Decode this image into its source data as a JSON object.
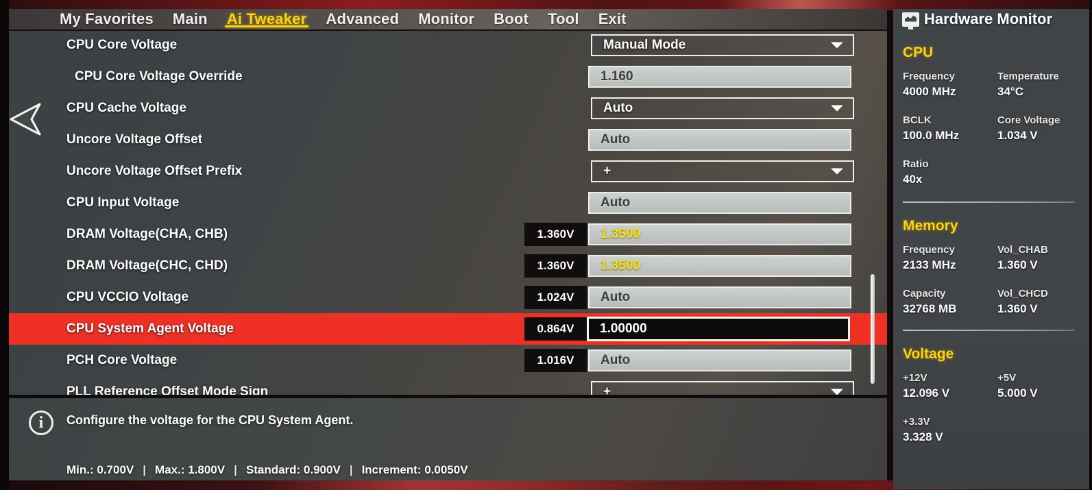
{
  "nav": {
    "items": [
      {
        "label": "My Favorites",
        "active": false
      },
      {
        "label": "Main",
        "active": false
      },
      {
        "label": "Ai Tweaker",
        "active": true
      },
      {
        "label": "Advanced",
        "active": false
      },
      {
        "label": "Monitor",
        "active": false
      },
      {
        "label": "Boot",
        "active": false
      },
      {
        "label": "Tool",
        "active": false
      },
      {
        "label": "Exit",
        "active": false
      }
    ]
  },
  "settings": {
    "rows": [
      {
        "label": "CPU Core Voltage",
        "indent": false,
        "control": "select",
        "value": "Manual Mode",
        "measured": null,
        "highlighted": false,
        "valueStyle": "normal"
      },
      {
        "label": "CPU Core Voltage Override",
        "indent": true,
        "control": "input",
        "value": "1.160",
        "measured": null,
        "highlighted": false,
        "valueStyle": "normal"
      },
      {
        "label": "CPU Cache Voltage",
        "indent": false,
        "control": "select",
        "value": "Auto",
        "measured": null,
        "highlighted": false,
        "valueStyle": "normal"
      },
      {
        "label": "Uncore Voltage Offset",
        "indent": false,
        "control": "input",
        "value": "Auto",
        "measured": null,
        "highlighted": false,
        "valueStyle": "normal"
      },
      {
        "label": "Uncore Voltage Offset Prefix",
        "indent": false,
        "control": "select",
        "value": "+",
        "measured": null,
        "highlighted": false,
        "valueStyle": "normal"
      },
      {
        "label": "CPU Input Voltage",
        "indent": false,
        "control": "input",
        "value": "Auto",
        "measured": null,
        "highlighted": false,
        "valueStyle": "normal"
      },
      {
        "label": "DRAM Voltage(CHA, CHB)",
        "indent": false,
        "control": "input",
        "value": "1.3500",
        "measured": "1.360V",
        "highlighted": false,
        "valueStyle": "yellow"
      },
      {
        "label": "DRAM Voltage(CHC, CHD)",
        "indent": false,
        "control": "input",
        "value": "1.3500",
        "measured": "1.360V",
        "highlighted": false,
        "valueStyle": "yellow"
      },
      {
        "label": "CPU VCCIO Voltage",
        "indent": false,
        "control": "input",
        "value": "Auto",
        "measured": "1.024V",
        "highlighted": false,
        "valueStyle": "normal"
      },
      {
        "label": "CPU System Agent Voltage",
        "indent": false,
        "control": "editing",
        "value": "1.00000",
        "measured": "0.864V",
        "highlighted": true,
        "valueStyle": "normal"
      },
      {
        "label": "PCH Core Voltage",
        "indent": false,
        "control": "input",
        "value": "Auto",
        "measured": "1.016V",
        "highlighted": false,
        "valueStyle": "normal"
      },
      {
        "label": "PLL Reference Offset Mode Sign",
        "indent": false,
        "control": "select",
        "value": "+",
        "measured": null,
        "highlighted": false,
        "valueStyle": "normal"
      }
    ]
  },
  "help": {
    "info_icon": "i",
    "description": "Configure the voltage for the CPU System Agent.",
    "limits": [
      "Min.: 0.700V",
      "Max.: 1.800V",
      "Standard: 0.900V",
      "Increment: 0.0050V"
    ],
    "separator": "|"
  },
  "sidebar": {
    "title": "Hardware Monitor",
    "groups": [
      {
        "title": "CPU",
        "cells": [
          {
            "key": "Frequency",
            "value": "4000 MHz"
          },
          {
            "key": "Temperature",
            "value": "34°C"
          },
          {
            "key": "BCLK",
            "value": "100.0 MHz"
          },
          {
            "key": "Core Voltage",
            "value": "1.034 V"
          },
          {
            "key": "Ratio",
            "value": "40x"
          }
        ]
      },
      {
        "title": "Memory",
        "cells": [
          {
            "key": "Frequency",
            "value": "2133 MHz"
          },
          {
            "key": "Vol_CHAB",
            "value": "1.360 V"
          },
          {
            "key": "Capacity",
            "value": "32768 MB"
          },
          {
            "key": "Vol_CHCD",
            "value": "1.360 V"
          }
        ]
      },
      {
        "title": "Voltage",
        "cells": [
          {
            "key": "+12V",
            "value": "12.096 V"
          },
          {
            "key": "+5V",
            "value": "5.000 V"
          },
          {
            "key": "+3.3V",
            "value": "3.328 V"
          }
        ]
      }
    ]
  },
  "colors": {
    "accent_yellow": "#ffd400",
    "highlight_red": "#ee3124",
    "panel_bg": "#3f4446",
    "nav_bg": "#55504c"
  }
}
